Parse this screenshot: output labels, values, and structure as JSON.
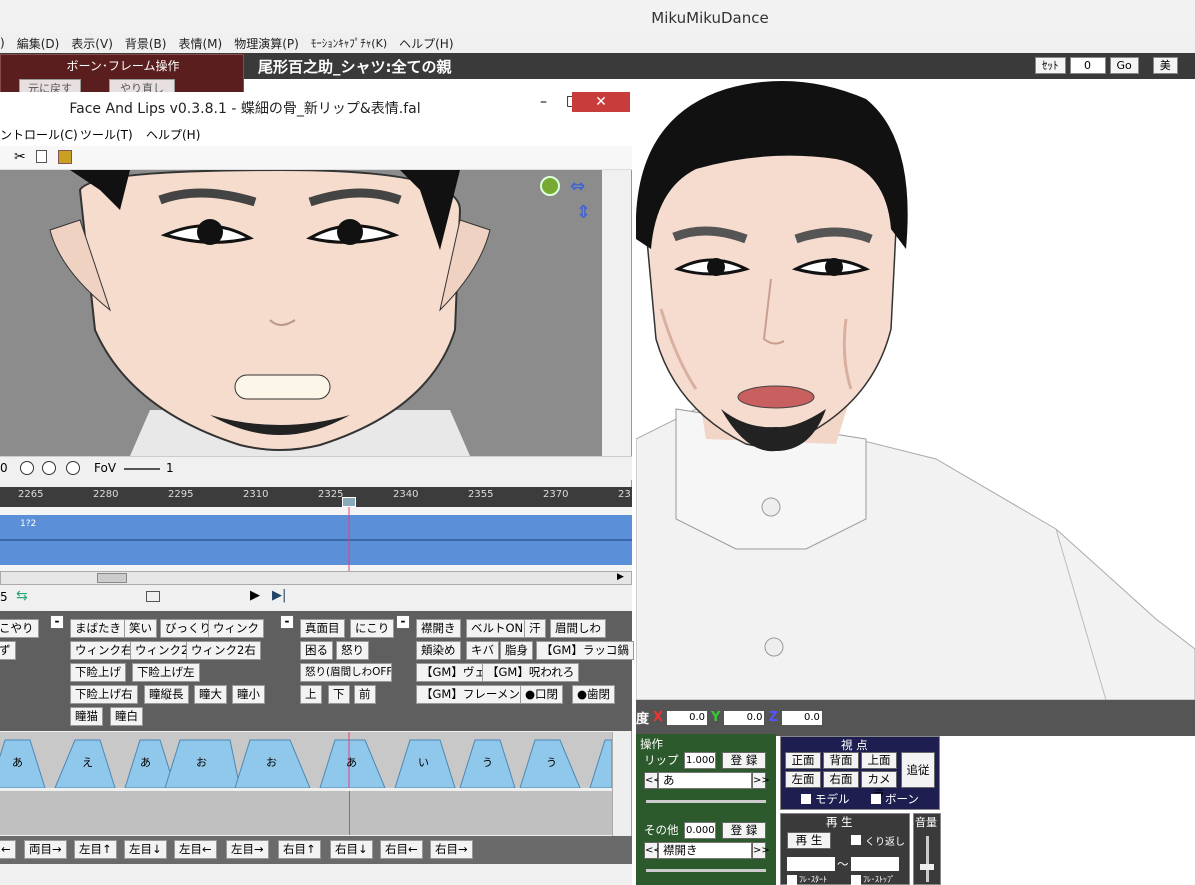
{
  "mmd": {
    "title": "MikuMikuDance",
    "menu": [
      ")",
      "編集(D)",
      "表示(V)",
      "背景(B)",
      "表情(M)",
      "物理演算(P)",
      "ﾓｰｼｮﾝｷｬﾌﾟﾁｬ(K)",
      "ヘルプ(H)"
    ],
    "bone_panel": {
      "title": "ボーン･フレーム操作",
      "undo": "元に戻す",
      "redo": "やり直し"
    },
    "viewport_title": "尾形百之助_シャツ:全ての親",
    "set_label": "ｾｯﾄ",
    "frame_value": "0",
    "go_label": "Go",
    "beauty_label": "美",
    "coord": {
      "label": "度",
      "x_label": "X",
      "x": "0.0",
      "y_label": "Y",
      "y": "0.0",
      "z_label": "Z",
      "z": "0.0"
    },
    "op_panel": {
      "title": "操作",
      "lip_label": "リップ",
      "lip_value": "1.000",
      "register": "登 録",
      "lip_select": "あ",
      "other_label": "その他",
      "other_value": "0.000",
      "other_select": "襟開き",
      "prev": "<<",
      "next": ">>"
    },
    "view_panel": {
      "title": "視 点",
      "front": "正面",
      "back": "背面",
      "top": "上面",
      "follow": "追従",
      "left": "左面",
      "right": "右面",
      "camera": "カメラ",
      "model": "モデル",
      "bone": "ボーン"
    },
    "play_panel": {
      "title": "再 生",
      "play": "再 生",
      "loop": "くり返し",
      "tilde": "～",
      "frame_start": "ﾌﾚ･ｽﾀｰﾄ",
      "frame_stop": "ﾌﾚ･ｽﾄｯﾌﾟ"
    },
    "volume": "音量"
  },
  "fal": {
    "title": "Face And Lips v0.3.8.1 - 蝶細の骨_新リップ&表情.fal",
    "minimize": "–",
    "maximize": "□",
    "close": "✕",
    "menu": [
      "ントロール(C)",
      "ツール(T)",
      "ヘルプ(H)"
    ],
    "fov_left": "0",
    "fov_label": "FoV",
    "fov_value": "1",
    "ruler": [
      "2265",
      "2280",
      "2295",
      "2310",
      "2325",
      "2340",
      "2355",
      "2370",
      "23"
    ],
    "wave_marker": "1?2",
    "morph_col0": [
      "こやり",
      "ず"
    ],
    "morph_eyes": [
      "まばたき",
      "笑い",
      "びっくり",
      "ウィンク",
      "ウィンク右",
      "ウィンク2",
      "ウィンク2右",
      "下睑上げ",
      "下睑上げ左",
      "下睑上げ右",
      "瞳縦長",
      "瞳大",
      "瞳小",
      "瞳猫",
      "瞳白"
    ],
    "morph_brow": [
      "真面目",
      "にこり",
      "困る",
      "怒り",
      "怒り(眉間しわOFF",
      "上",
      "下",
      "前"
    ],
    "morph_other": [
      "襟開き",
      "ベルトON",
      "汗",
      "眉間しわ",
      "頬染め",
      "キバ",
      "脂身",
      "【GM】ラッコ鍋",
      "【GM】ヴェッ",
      "【GM】呪われろ",
      "【GM】フレーメン反応",
      "●口閉",
      "●歯閉"
    ],
    "lip_keys": [
      "あ",
      "え",
      "あ",
      "お",
      "お",
      "あ",
      "い",
      "う",
      "う"
    ],
    "eye_buttons": [
      "←",
      "両目→",
      "左目↑",
      "左目↓",
      "左目←",
      "左目→",
      "右目↑",
      "右目↓",
      "右目←",
      "右目→"
    ],
    "tb_num": "5"
  },
  "colors": {
    "accent_red": "#c83c3c",
    "bone_panel": "#5a1e1e",
    "op_panel": "#2d5a2d",
    "view_panel": "#1e1e50",
    "waveform": "#5b8fd8"
  }
}
